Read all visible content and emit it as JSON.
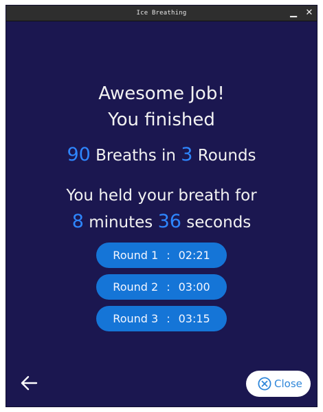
{
  "window": {
    "title": "Ice Breathing",
    "minimize_icon": "minimize-icon",
    "close_icon": "close-icon"
  },
  "summary": {
    "heading_line1": "Awesome Job!",
    "heading_line2": "You finished",
    "breaths": "90",
    "breaths_label": "Breaths in",
    "rounds": "3",
    "rounds_label": "Rounds",
    "held_label": "You held your breath for",
    "minutes": "8",
    "minutes_label": "minutes",
    "seconds": "36",
    "seconds_label": "seconds"
  },
  "rounds": [
    {
      "label": "Round 1",
      "separator": ":",
      "time": "02:21"
    },
    {
      "label": "Round 2",
      "separator": ":",
      "time": "03:00"
    },
    {
      "label": "Round 3",
      "separator": ":",
      "time": "03:15"
    }
  ],
  "footer": {
    "back_icon": "arrow-left-icon",
    "close_label": "Close",
    "close_icon": "circle-x-icon"
  },
  "colors": {
    "background": "#1b1750",
    "accent": "#2e86ff",
    "pill": "#1575d7",
    "titlebar": "#2e2e2e"
  }
}
